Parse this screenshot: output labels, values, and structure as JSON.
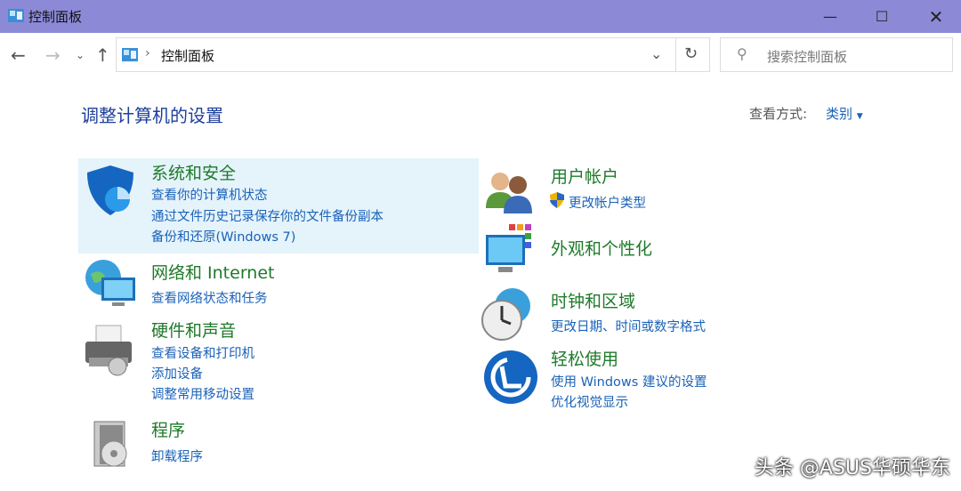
{
  "window": {
    "title": "控制面板"
  },
  "address": {
    "breadcrumb": "控制面板",
    "search_placeholder": "搜索控制面板"
  },
  "page": {
    "heading": "调整计算机的设置",
    "view_by_label": "查看方式:",
    "view_by_value": "类别"
  },
  "categories": {
    "system": {
      "title": "系统和安全",
      "links": [
        "查看你的计算机状态",
        "通过文件历史记录保存你的文件备份副本",
        "备份和还原(Windows 7)"
      ]
    },
    "network": {
      "title": "网络和 Internet",
      "links": [
        "查看网络状态和任务"
      ]
    },
    "hardware": {
      "title": "硬件和声音",
      "links": [
        "查看设备和打印机",
        "添加设备",
        "调整常用移动设置"
      ]
    },
    "programs": {
      "title": "程序",
      "links": [
        "卸载程序"
      ]
    },
    "users": {
      "title": "用户帐户",
      "links": [
        "更改帐户类型"
      ]
    },
    "appearance": {
      "title": "外观和个性化",
      "links": []
    },
    "clock": {
      "title": "时钟和区域",
      "links": [
        "更改日期、时间或数字格式"
      ]
    },
    "ease": {
      "title": "轻松使用",
      "links": [
        "使用 Windows 建议的设置",
        "优化视觉显示"
      ]
    }
  },
  "watermark": "头条 @ASUS华硕华东",
  "colors": {
    "titlebar": "#8c8ad6",
    "category": "#1f7a2a",
    "link": "#1a62b8",
    "highlight": "#e5f3fb"
  }
}
